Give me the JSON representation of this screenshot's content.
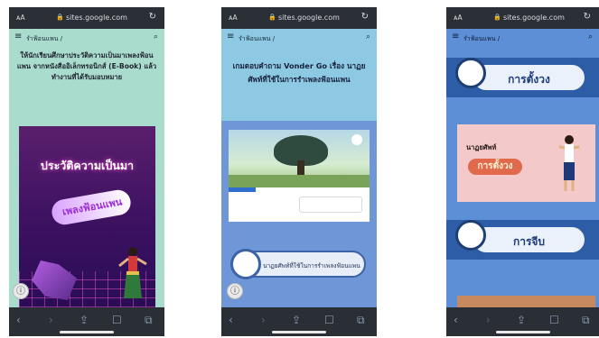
{
  "phones": [
    {
      "browser": {
        "aa_label": "ᴀA",
        "url": "sites.google.com"
      },
      "nav": {
        "title": "รำฟ้อนแพน /"
      },
      "text": "ให้นักเรียนศึกษาประวัติความเป็นมาเพลงฟ้อนแพน จากหนังสืออิเล็กทรอนิกส์ (E-Book) แล้วทำงานที่ได้รับมอบหมาย",
      "ebook_title": "ประวัติความเป็นมา",
      "ebook_subtitle": "เพลงฟ้อนแพน"
    },
    {
      "browser": {
        "aa_label": "ᴀA",
        "url": "sites.google.com"
      },
      "nav": {
        "title": "รำฟ้อนแพน /"
      },
      "heading": "เกมตอบคำถาม Vonder Go เรื่อง นาฏยศัพท์ที่ใช้ในการรำเพลงฟ้อนแพน",
      "button_label": "นาฏยศัพท์ที่ใช้ในการรำเพลงฟ้อนแพน"
    },
    {
      "browser": {
        "aa_label": "ᴀA",
        "url": "sites.google.com"
      },
      "nav": {
        "title": "รำฟ้อนแพน /"
      },
      "pill_top": "การตั้งวง",
      "card_small": "นาฏยศัพท์",
      "card_big": "การตั้งวง",
      "pill_bottom": "การจีบ"
    }
  ],
  "icons": {
    "menu": "menu-icon",
    "search": "search-icon",
    "reload": "reload-icon",
    "lock": "lock-icon",
    "back": "back-arrow-icon",
    "forward": "forward-arrow-icon",
    "share": "share-icon",
    "bookmarks": "bookmarks-icon",
    "tabs": "tabs-icon",
    "info": "info-icon"
  },
  "colors": {
    "phone1_bg": "#a9dccc",
    "phone2_bg": "#6f96d6",
    "phone3_bg": "#5d8fd6",
    "ebook_purple": "#5a1f6d"
  }
}
